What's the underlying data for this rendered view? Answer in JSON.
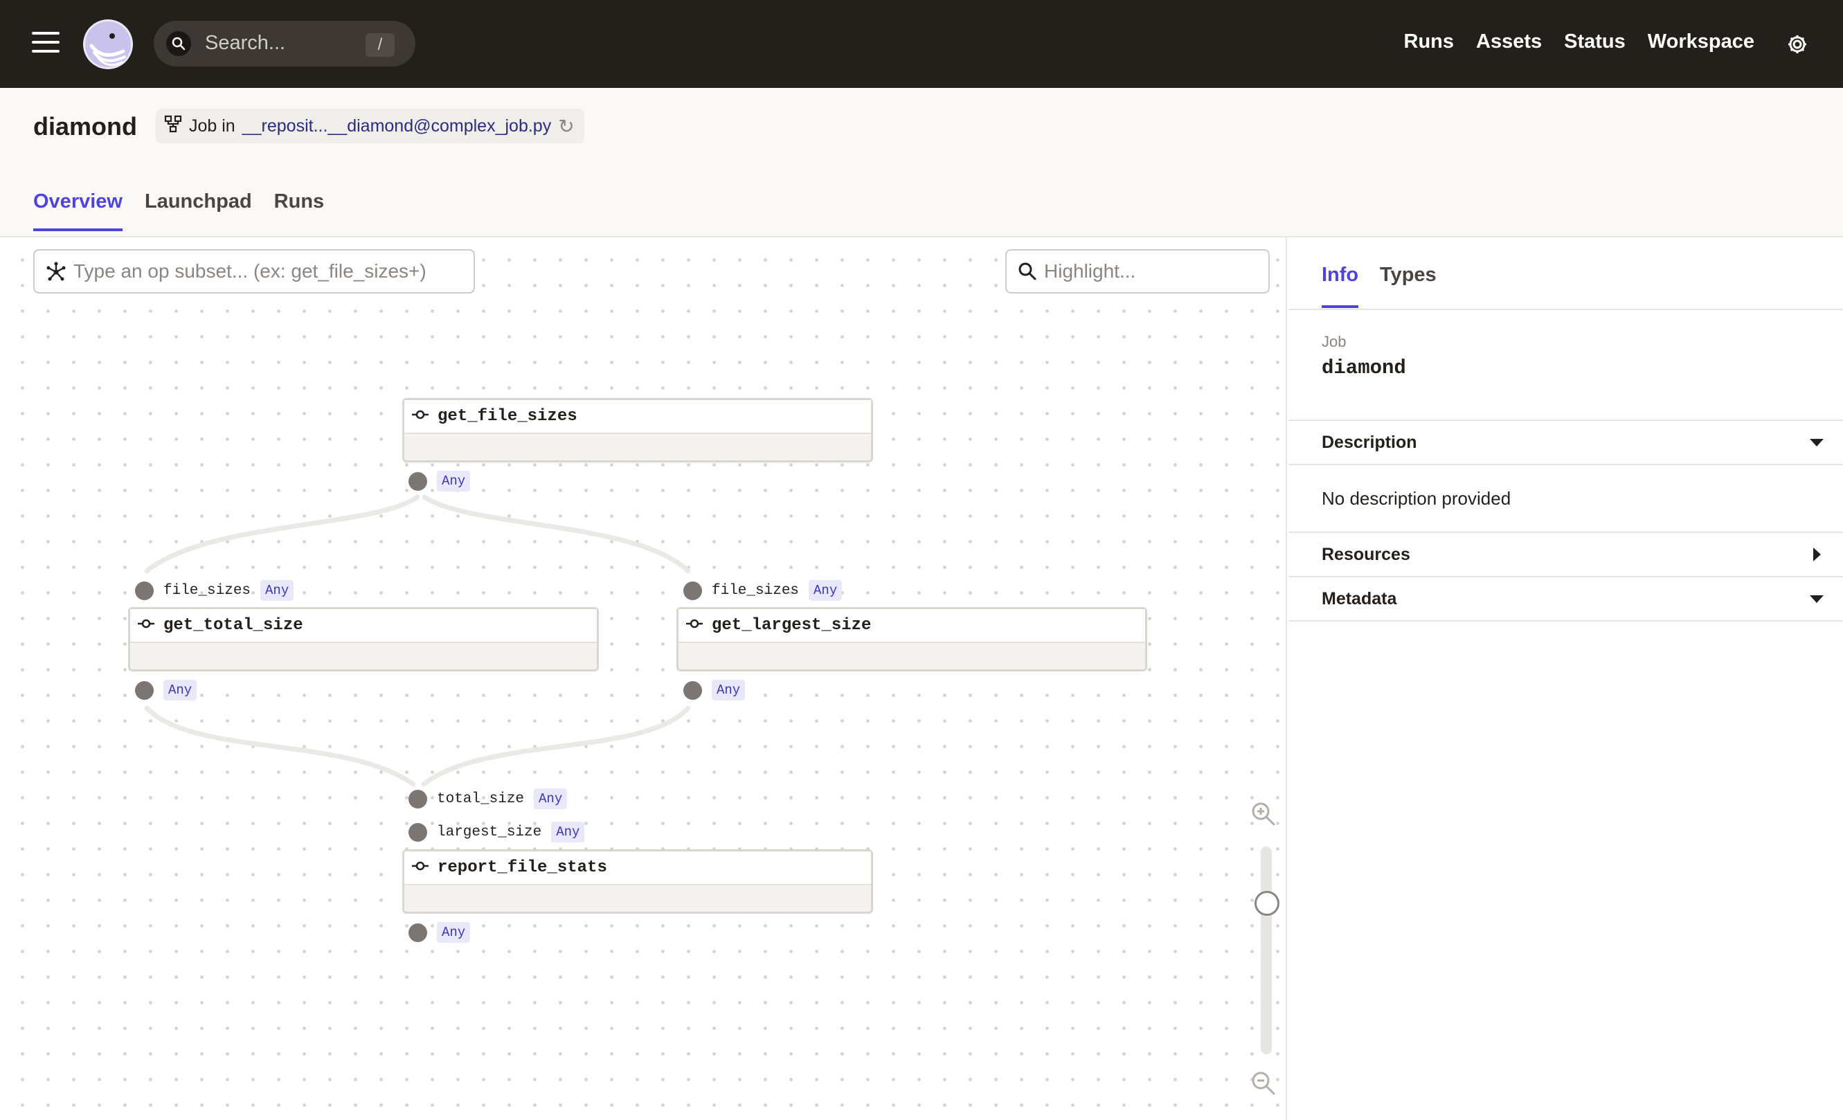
{
  "topnav": {
    "search_placeholder": "Search...",
    "search_shortcut": "/",
    "links": [
      "Runs",
      "Assets",
      "Status",
      "Workspace"
    ]
  },
  "header": {
    "title": "diamond",
    "job_prefix": "Job in",
    "repo_link": "__reposit...__diamond@complex_job.py",
    "tabs": [
      "Overview",
      "Launchpad",
      "Runs"
    ],
    "active_tab": "Overview"
  },
  "graph": {
    "op_subset_placeholder": "Type an op subset... (ex: get_file_sizes+)",
    "highlight_placeholder": "Highlight...",
    "nodes": [
      {
        "name": "get_file_sizes",
        "inputs": [],
        "output_type": "Any"
      },
      {
        "name": "get_total_size",
        "inputs": [
          {
            "name": "file_sizes",
            "type": "Any"
          }
        ],
        "output_type": "Any"
      },
      {
        "name": "get_largest_size",
        "inputs": [
          {
            "name": "file_sizes",
            "type": "Any"
          }
        ],
        "output_type": "Any"
      },
      {
        "name": "report_file_stats",
        "inputs": [
          {
            "name": "total_size",
            "type": "Any"
          },
          {
            "name": "largest_size",
            "type": "Any"
          }
        ],
        "output_type": "Any"
      }
    ]
  },
  "sidepanel": {
    "tabs": [
      "Info",
      "Types"
    ],
    "active_tab": "Info",
    "job_label": "Job",
    "job_name": "diamond",
    "sections": {
      "description": {
        "title": "Description",
        "body": "No description provided",
        "expanded": true
      },
      "resources": {
        "title": "Resources",
        "expanded": false
      },
      "metadata": {
        "title": "Metadata",
        "expanded": true
      }
    }
  },
  "colors": {
    "accent": "#4f43dd",
    "topbar": "#231f1b",
    "type_badge_bg": "#e9e8fb",
    "port_dot": "#7b7672"
  }
}
